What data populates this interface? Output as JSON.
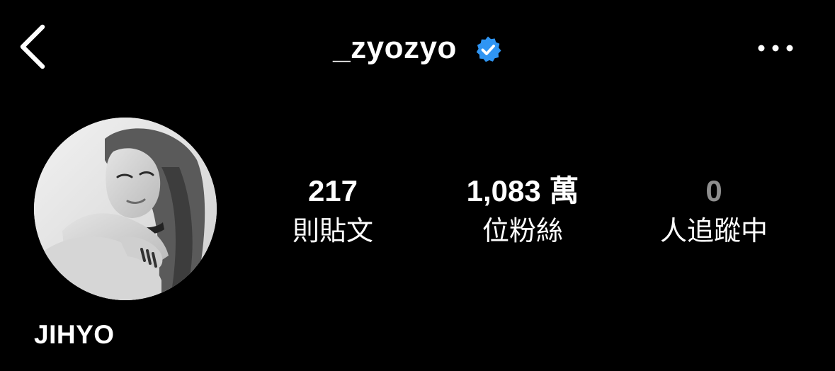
{
  "header": {
    "username": "_zyozyo",
    "verified": true,
    "back_icon": "chevron-left-icon",
    "more_icon": "more-horizontal-icon",
    "verified_icon": "verified-badge-icon"
  },
  "profile": {
    "display_name": "JIHYO",
    "avatar_description": "profile-photo"
  },
  "stats": {
    "posts": {
      "value": "217",
      "label": "則貼文"
    },
    "followers": {
      "value": "1,083 萬",
      "label": "位粉絲"
    },
    "following": {
      "value": "0",
      "label": "人追蹤中"
    }
  },
  "colors": {
    "background": "#000000",
    "text": "#ffffff",
    "verified_blue": "#2f95f3",
    "muted": "#8e8e8e"
  }
}
